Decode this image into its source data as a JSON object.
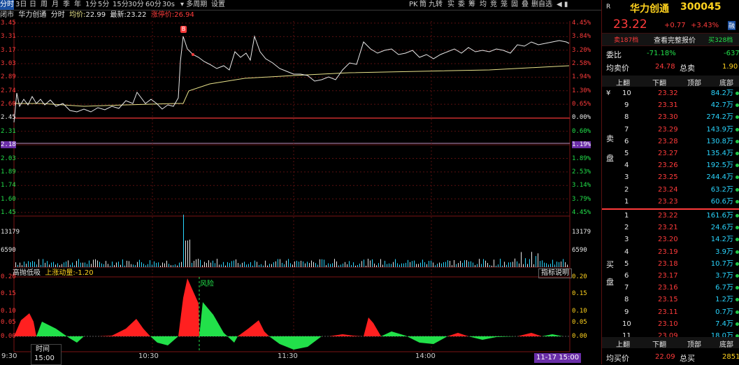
{
  "colors": {
    "up": "#ff3b3b",
    "down": "#22e04a",
    "price": "#e8e8e8",
    "avg": "#e8e28a",
    "grid": "#5a1010",
    "accent": "#1a4fa0",
    "cyan": "#2ad6ff"
  },
  "toolbar": {
    "tabs": [
      "分时",
      "3日",
      "日",
      "周",
      "月",
      "季",
      "年",
      "1分",
      "5分",
      "15分",
      "30分",
      "60分",
      "30s",
      "▾ 多周期",
      "设置"
    ],
    "right_tools": [
      "PK",
      "筒",
      "九转",
      "实",
      "委",
      "筹",
      "均",
      "竞",
      "笼",
      "固",
      "叠",
      "删自选",
      "◀ ▮"
    ],
    "window_icons": [
      "⊙",
      "◎",
      "👁",
      "🖐",
      "⚙",
      "✕"
    ]
  },
  "info": {
    "market": "闭市",
    "name": "华力创通",
    "mode": "分时",
    "avg_label": "均价:",
    "avg_value": "22.99",
    "last_label": "最新:",
    "last_value": "23.22",
    "limit_label": "涨停价:",
    "limit_value": "26.94"
  },
  "price_axis": {
    "left": [
      "3.45",
      "3.31",
      "3.17",
      "3.03",
      "2.89",
      "2.74",
      "2.60",
      "2.45",
      "2.31",
      "2.18",
      "2.03",
      "1.89",
      "1.74",
      "1.60",
      "1.45"
    ],
    "right": [
      "4.45%",
      "3.84%",
      "3.20%",
      "2.58%",
      "1.94%",
      "1.30%",
      "0.65%",
      "0.00%",
      "0.60%",
      "1.19%",
      "1.89%",
      "2.53%",
      "3.14%",
      "3.79%",
      "4.45%"
    ]
  },
  "volume_axis": {
    "left": [
      "13179",
      "6590"
    ],
    "right": [
      "13179",
      "6590"
    ]
  },
  "indicator": {
    "title": "高抛低吸",
    "param_label": "上涨动量:",
    "param_value": "-1.20",
    "explain": "指标说明",
    "risk_label": "风险",
    "left": [
      "0.20",
      "0.15",
      "0.10",
      "0.05",
      "0.00"
    ],
    "right": [
      "0.20",
      "0.15",
      "0.10",
      "0.05",
      "0.00"
    ]
  },
  "time_axis": {
    "labels": [
      "9:30",
      "10:30",
      "11:30",
      "14:00"
    ],
    "end_badge": "11-17 15:00"
  },
  "cursor": {
    "label": "时间",
    "value": "15:00",
    "marker": "B"
  },
  "quote": {
    "badge": "R",
    "name": "华力创通",
    "code": "300045",
    "price": "23.22",
    "change": "+0.77",
    "pct": "+3.43%",
    "pct_icon": "融",
    "bar_left": "卖187档",
    "bar_mid": "查看完整报价",
    "bar_right": "买328档",
    "wb_label": "委比",
    "wb_value": "-71.18%",
    "wb_diff": "-637",
    "avg_sell_label": "均卖价",
    "avg_sell_value": "24.78",
    "total_sell_label": "总卖",
    "total_sell_value": "1.90"
  },
  "book_header": {
    "col1": "上翻",
    "col2": "下翻",
    "col3": "顶部",
    "col4": "底部"
  },
  "sell_side_label": [
    "¥",
    "卖",
    "盘"
  ],
  "buy_side_label": [
    "买",
    "盘"
  ],
  "asks": [
    {
      "n": "10",
      "p": "23.32",
      "v": "84.2万"
    },
    {
      "n": "9",
      "p": "23.31",
      "v": "42.7万"
    },
    {
      "n": "8",
      "p": "23.30",
      "v": "274.2万"
    },
    {
      "n": "7",
      "p": "23.29",
      "v": "143.9万"
    },
    {
      "n": "6",
      "p": "23.28",
      "v": "130.8万"
    },
    {
      "n": "5",
      "p": "23.27",
      "v": "135.4万"
    },
    {
      "n": "4",
      "p": "23.26",
      "v": "192.5万"
    },
    {
      "n": "3",
      "p": "23.25",
      "v": "244.4万"
    },
    {
      "n": "2",
      "p": "23.24",
      "v": "63.2万"
    },
    {
      "n": "1",
      "p": "23.23",
      "v": "60.6万"
    }
  ],
  "bids": [
    {
      "n": "1",
      "p": "23.22",
      "v": "161.6万"
    },
    {
      "n": "2",
      "p": "23.21",
      "v": "24.6万"
    },
    {
      "n": "3",
      "p": "23.20",
      "v": "14.2万"
    },
    {
      "n": "4",
      "p": "23.19",
      "v": "3.9万"
    },
    {
      "n": "5",
      "p": "23.18",
      "v": "10.7万"
    },
    {
      "n": "6",
      "p": "23.17",
      "v": "3.7万"
    },
    {
      "n": "7",
      "p": "23.16",
      "v": "6.7万"
    },
    {
      "n": "8",
      "p": "23.15",
      "v": "1.2万"
    },
    {
      "n": "9",
      "p": "23.11",
      "v": "0.7万"
    },
    {
      "n": "10",
      "p": "23.10",
      "v": "7.4万"
    },
    {
      "n": "11",
      "p": "23.09",
      "v": "18.0万"
    }
  ],
  "book_footer": {
    "col1": "上翻",
    "col2": "下翻",
    "col3": "顶部",
    "col4": "底部"
  },
  "bottom": {
    "avg_buy_label": "均买价",
    "avg_buy_value": "22.09",
    "total_buy_label": "总买",
    "total_buy_value": "2851"
  }
}
